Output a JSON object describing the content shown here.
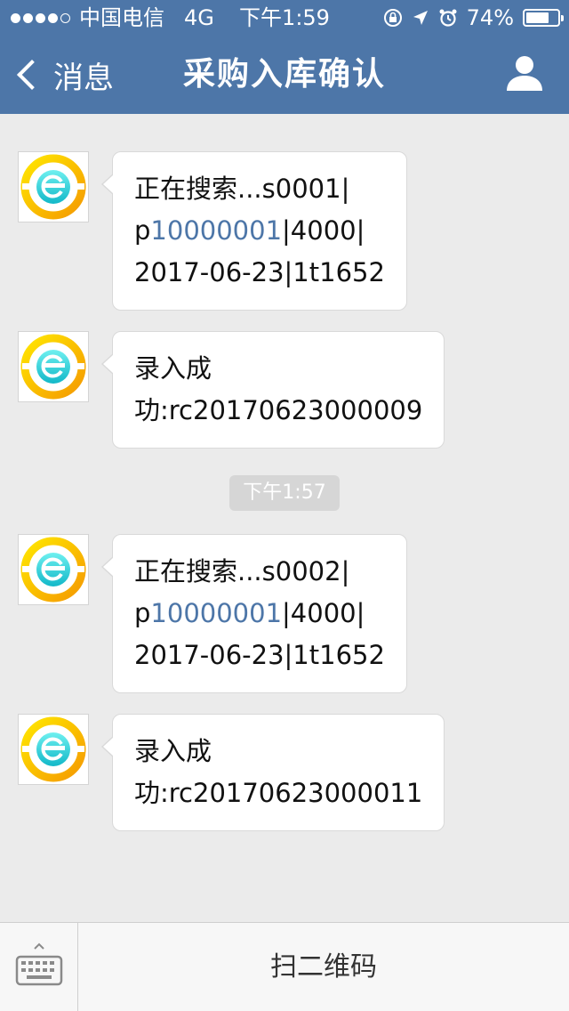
{
  "status_bar": {
    "carrier": "中国电信",
    "network": "4G",
    "time": "下午1:59",
    "battery": "74%",
    "battery_level": 0.74
  },
  "nav": {
    "back_label": "消息",
    "title": "采购入库确认"
  },
  "messages": [
    {
      "line1": "正在搜索...s0001|",
      "line2_prefix": "p",
      "line2_link": "10000001",
      "line2_suffix": "|4000|",
      "line3": "2017-06-23|1t1652"
    },
    {
      "line1": "录入成",
      "line2": "功:rc20170623000009"
    },
    {
      "line1": "正在搜索...s0002|",
      "line2_prefix": "p",
      "line2_link": "10000001",
      "line2_suffix": "|4000|",
      "line3": "2017-06-23|1t1652"
    },
    {
      "line1": "录入成",
      "line2": "功:rc20170623000011"
    }
  ],
  "timestamp": "下午1:57",
  "bottom_bar": {
    "button_label": "扫二维码"
  },
  "colors": {
    "nav_background": "#4d76a8",
    "link": "#4d76a8",
    "chat_background": "#ebebeb"
  },
  "icons": {
    "back": "chevron-left-icon",
    "profile": "person-icon",
    "keyboard": "keyboard-icon",
    "avatar": "e-logo-icon"
  }
}
